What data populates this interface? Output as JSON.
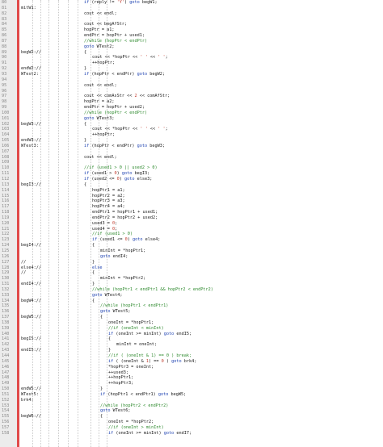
{
  "editor": {
    "lines": [
      {
        "n": "80",
        "label": "",
        "indent": 0,
        "text": "if (reply != 'Y') goto begW1;",
        "kind": "code"
      },
      {
        "n": "81",
        "label": "mitW1:",
        "indent": 0,
        "text": "",
        "kind": "code"
      },
      {
        "n": "82",
        "label": "",
        "indent": 0,
        "text": "cout << endl;",
        "kind": "code"
      },
      {
        "n": "83",
        "label": "",
        "indent": 0,
        "text": "",
        "kind": "code"
      },
      {
        "n": "84",
        "label": "",
        "indent": 0,
        "text": "cout << begAfStr;",
        "kind": "code"
      },
      {
        "n": "85",
        "label": "",
        "indent": 0,
        "text": "hopPtr = a1;",
        "kind": "code"
      },
      {
        "n": "86",
        "label": "",
        "indent": 0,
        "text": "endPtr = hopPtr + used1;",
        "kind": "code"
      },
      {
        "n": "87",
        "label": "",
        "indent": 0,
        "text": "//while (hopPtr < endPtr)",
        "kind": "comment"
      },
      {
        "n": "88",
        "label": "",
        "indent": 0,
        "text": "goto WTest2;",
        "kind": "code"
      },
      {
        "n": "89",
        "label": "begW2://",
        "indent": 0,
        "text": "{",
        "kind": "code"
      },
      {
        "n": "90",
        "label": "",
        "indent": 1,
        "text": "cout << *hopPtr << ' ' << ' ';",
        "kind": "code"
      },
      {
        "n": "91",
        "label": "",
        "indent": 1,
        "text": "++hopPtr;",
        "kind": "code"
      },
      {
        "n": "92",
        "label": "endW2://",
        "indent": 0,
        "text": "}",
        "kind": "code"
      },
      {
        "n": "93",
        "label": "WTest2:",
        "indent": 0,
        "text": "if (hopPtr < endPtr) goto begW2;",
        "kind": "code"
      },
      {
        "n": "94",
        "label": "",
        "indent": 0,
        "text": "",
        "kind": "code"
      },
      {
        "n": "95",
        "label": "",
        "indent": 0,
        "text": "cout << endl;",
        "kind": "code"
      },
      {
        "n": "96",
        "label": "",
        "indent": 0,
        "text": "",
        "kind": "code"
      },
      {
        "n": "97",
        "label": "",
        "indent": 0,
        "text": "cout << comAsStr << 2 << comAfStr;",
        "kind": "code"
      },
      {
        "n": "98",
        "label": "",
        "indent": 0,
        "text": "hopPtr = a2;",
        "kind": "code"
      },
      {
        "n": "99",
        "label": "",
        "indent": 0,
        "text": "endPtr = hopPtr + used2;",
        "kind": "code"
      },
      {
        "n": "100",
        "label": "",
        "indent": 0,
        "text": "//while (hopPtr < endPtr)",
        "kind": "comment"
      },
      {
        "n": "101",
        "label": "",
        "indent": 0,
        "text": "goto WTest3;",
        "kind": "code"
      },
      {
        "n": "102",
        "label": "begW3://",
        "indent": 0,
        "text": "{",
        "kind": "code"
      },
      {
        "n": "103",
        "label": "",
        "indent": 1,
        "text": "cout << *hopPtr << ' ' << ' ';",
        "kind": "code"
      },
      {
        "n": "104",
        "label": "",
        "indent": 1,
        "text": "++hopPtr;",
        "kind": "code"
      },
      {
        "n": "105",
        "label": "endW3://",
        "indent": 0,
        "text": "}",
        "kind": "code"
      },
      {
        "n": "106",
        "label": "WTest3:",
        "indent": 0,
        "text": "if (hopPtr < endPtr) goto begW3;",
        "kind": "code"
      },
      {
        "n": "107",
        "label": "",
        "indent": 0,
        "text": "",
        "kind": "code"
      },
      {
        "n": "108",
        "label": "",
        "indent": 0,
        "text": "cout << endl;",
        "kind": "code"
      },
      {
        "n": "109",
        "label": "",
        "indent": 0,
        "text": "",
        "kind": "code"
      },
      {
        "n": "110",
        "label": "",
        "indent": 0,
        "text": "//if (used1 > 0 || used2 > 0)",
        "kind": "comment"
      },
      {
        "n": "111",
        "label": "",
        "indent": 0,
        "text": "if (used1 > 0) goto begI3;",
        "kind": "code"
      },
      {
        "n": "112",
        "label": "",
        "indent": 0,
        "text": "if (used2 <= 0) goto else3;",
        "kind": "code"
      },
      {
        "n": "113",
        "label": "begI3://",
        "indent": 0,
        "text": "{",
        "kind": "code"
      },
      {
        "n": "114",
        "label": "",
        "indent": 1,
        "text": "hopPtr1 = a1;",
        "kind": "code"
      },
      {
        "n": "115",
        "label": "",
        "indent": 1,
        "text": "hopPtr2 = a2;",
        "kind": "code"
      },
      {
        "n": "116",
        "label": "",
        "indent": 1,
        "text": "hopPtr3 = a3;",
        "kind": "code"
      },
      {
        "n": "117",
        "label": "",
        "indent": 1,
        "text": "hopPtr4 = a4;",
        "kind": "code"
      },
      {
        "n": "118",
        "label": "",
        "indent": 1,
        "text": "endPtr1 = hopPtr1 + used1;",
        "kind": "code"
      },
      {
        "n": "119",
        "label": "",
        "indent": 1,
        "text": "endPtr2 = hopPtr2 + used2;",
        "kind": "code"
      },
      {
        "n": "120",
        "label": "",
        "indent": 1,
        "text": "used3 = 0;",
        "kind": "code"
      },
      {
        "n": "121",
        "label": "",
        "indent": 1,
        "text": "used4 = 0;",
        "kind": "code"
      },
      {
        "n": "122",
        "label": "",
        "indent": 1,
        "text": "//if (used1 > 0)",
        "kind": "comment"
      },
      {
        "n": "123",
        "label": "",
        "indent": 1,
        "text": "if (used1 <= 0) goto else4;",
        "kind": "code"
      },
      {
        "n": "124",
        "label": "begI4://",
        "indent": 1,
        "text": "{",
        "kind": "code"
      },
      {
        "n": "125",
        "label": "",
        "indent": 2,
        "text": "minInt = *hopPtr1;",
        "kind": "code"
      },
      {
        "n": "126",
        "label": "",
        "indent": 2,
        "text": "goto endI4;",
        "kind": "code"
      },
      {
        "n": "127",
        "label": "//",
        "indent": 1,
        "text": "}",
        "kind": "code"
      },
      {
        "n": "128",
        "label": "else4://",
        "indent": 1,
        "text": "else",
        "kind": "code"
      },
      {
        "n": "129",
        "label": "//",
        "indent": 1,
        "text": "{",
        "kind": "code"
      },
      {
        "n": "130",
        "label": "",
        "indent": 2,
        "text": "minInt = *hopPtr2;",
        "kind": "code"
      },
      {
        "n": "131",
        "label": "endI4://",
        "indent": 1,
        "text": "}",
        "kind": "code"
      },
      {
        "n": "132",
        "label": "",
        "indent": 1,
        "text": "//while (hopPtr1 < endPtr1 && hopPtr2 < endPtr2)",
        "kind": "comment"
      },
      {
        "n": "133",
        "label": "",
        "indent": 1,
        "text": "goto WTest4;",
        "kind": "code"
      },
      {
        "n": "134",
        "label": "begW4://",
        "indent": 1,
        "text": "{",
        "kind": "code"
      },
      {
        "n": "135",
        "label": "",
        "indent": 2,
        "text": "//while (hopPtr1 < endPtr1)",
        "kind": "comment"
      },
      {
        "n": "136",
        "label": "",
        "indent": 2,
        "text": "goto WTest5;",
        "kind": "code"
      },
      {
        "n": "137",
        "label": "begW5://",
        "indent": 2,
        "text": "{",
        "kind": "code"
      },
      {
        "n": "138",
        "label": "",
        "indent": 3,
        "text": "oneInt = *hopPtr1;",
        "kind": "code"
      },
      {
        "n": "139",
        "label": "",
        "indent": 3,
        "text": "//if (oneInt < minInt)",
        "kind": "comment"
      },
      {
        "n": "140",
        "label": "",
        "indent": 3,
        "text": "if (oneInt >= minInt) goto endI5;",
        "kind": "code"
      },
      {
        "n": "141",
        "label": "begI5://",
        "indent": 3,
        "text": "{",
        "kind": "code"
      },
      {
        "n": "142",
        "label": "",
        "indent": 4,
        "text": "minInt = oneInt;",
        "kind": "code"
      },
      {
        "n": "143",
        "label": "endI5://",
        "indent": 3,
        "text": "}",
        "kind": "code"
      },
      {
        "n": "144",
        "label": "",
        "indent": 3,
        "text": "//if ( (oneInt & 1) == 0 ) break;",
        "kind": "comment"
      },
      {
        "n": "145",
        "label": "",
        "indent": 3,
        "text": "if ( (oneInt & 1) == 0 ) goto brk4;",
        "kind": "code"
      },
      {
        "n": "146",
        "label": "",
        "indent": 3,
        "text": "*hopPtr3 = oneInt;",
        "kind": "code"
      },
      {
        "n": "147",
        "label": "",
        "indent": 3,
        "text": "++used3;",
        "kind": "code"
      },
      {
        "n": "148",
        "label": "",
        "indent": 3,
        "text": "++hopPtr1;",
        "kind": "code"
      },
      {
        "n": "149",
        "label": "",
        "indent": 3,
        "text": "++hopPtr3;",
        "kind": "code"
      },
      {
        "n": "150",
        "label": "endW5://",
        "indent": 2,
        "text": "}",
        "kind": "code"
      },
      {
        "n": "151",
        "label": "WTest5:",
        "indent": 2,
        "text": "if (hopPtr1 < endPtr1) goto begW5;",
        "kind": "code"
      },
      {
        "n": "152",
        "label": "brk4:",
        "indent": 0,
        "text": "",
        "kind": "code"
      },
      {
        "n": "153",
        "label": "",
        "indent": 2,
        "text": "//while (hopPtr2 < endPtr2)",
        "kind": "comment"
      },
      {
        "n": "154",
        "label": "",
        "indent": 2,
        "text": "goto WTest6;",
        "kind": "code"
      },
      {
        "n": "155",
        "label": "begW6://",
        "indent": 2,
        "text": "{",
        "kind": "code"
      },
      {
        "n": "156",
        "label": "",
        "indent": 3,
        "text": "oneInt = *hopPtr2;",
        "kind": "code"
      },
      {
        "n": "157",
        "label": "",
        "indent": 3,
        "text": "//if (oneInt > minInt)",
        "kind": "comment"
      },
      {
        "n": "158",
        "label": "",
        "indent": 3,
        "text": "if (oneInt >= minInt) goto endI7;",
        "kind": "code"
      }
    ]
  }
}
